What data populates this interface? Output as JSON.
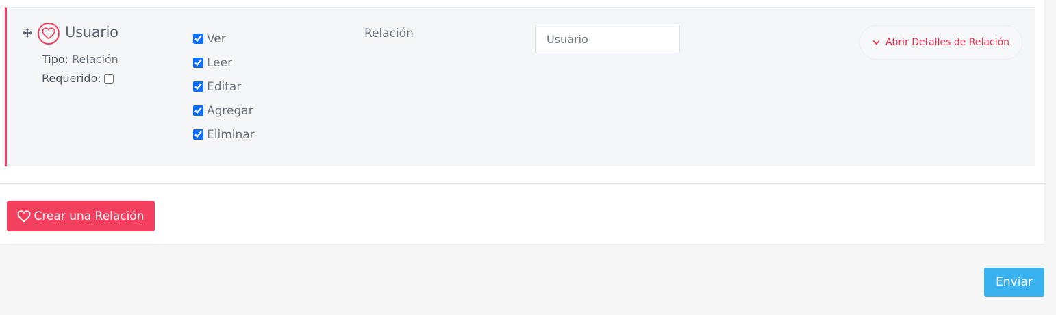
{
  "field": {
    "name": "Usuario",
    "type_key": "Tipo:",
    "type_value": "Relación",
    "required_label": "Requerido:",
    "required_checked": false,
    "icons": {
      "drag": "move-arrows-icon",
      "type": "heart-icon"
    },
    "permissions": [
      {
        "label": "Ver",
        "checked": true
      },
      {
        "label": "Leer",
        "checked": true
      },
      {
        "label": "Editar",
        "checked": true
      },
      {
        "label": "Agregar",
        "checked": true
      },
      {
        "label": "Eliminar",
        "checked": true
      }
    ],
    "type_display": "Relación",
    "name_input_value": "Usuario",
    "details_button": "Abrir Detalles de Relación"
  },
  "actions": {
    "create_relation": "Crear una Relación",
    "submit": "Enviar"
  },
  "colors": {
    "accent": "#f0405f",
    "primary_blue": "#3ab1ef",
    "checkbox_blue": "#0d6efd"
  }
}
